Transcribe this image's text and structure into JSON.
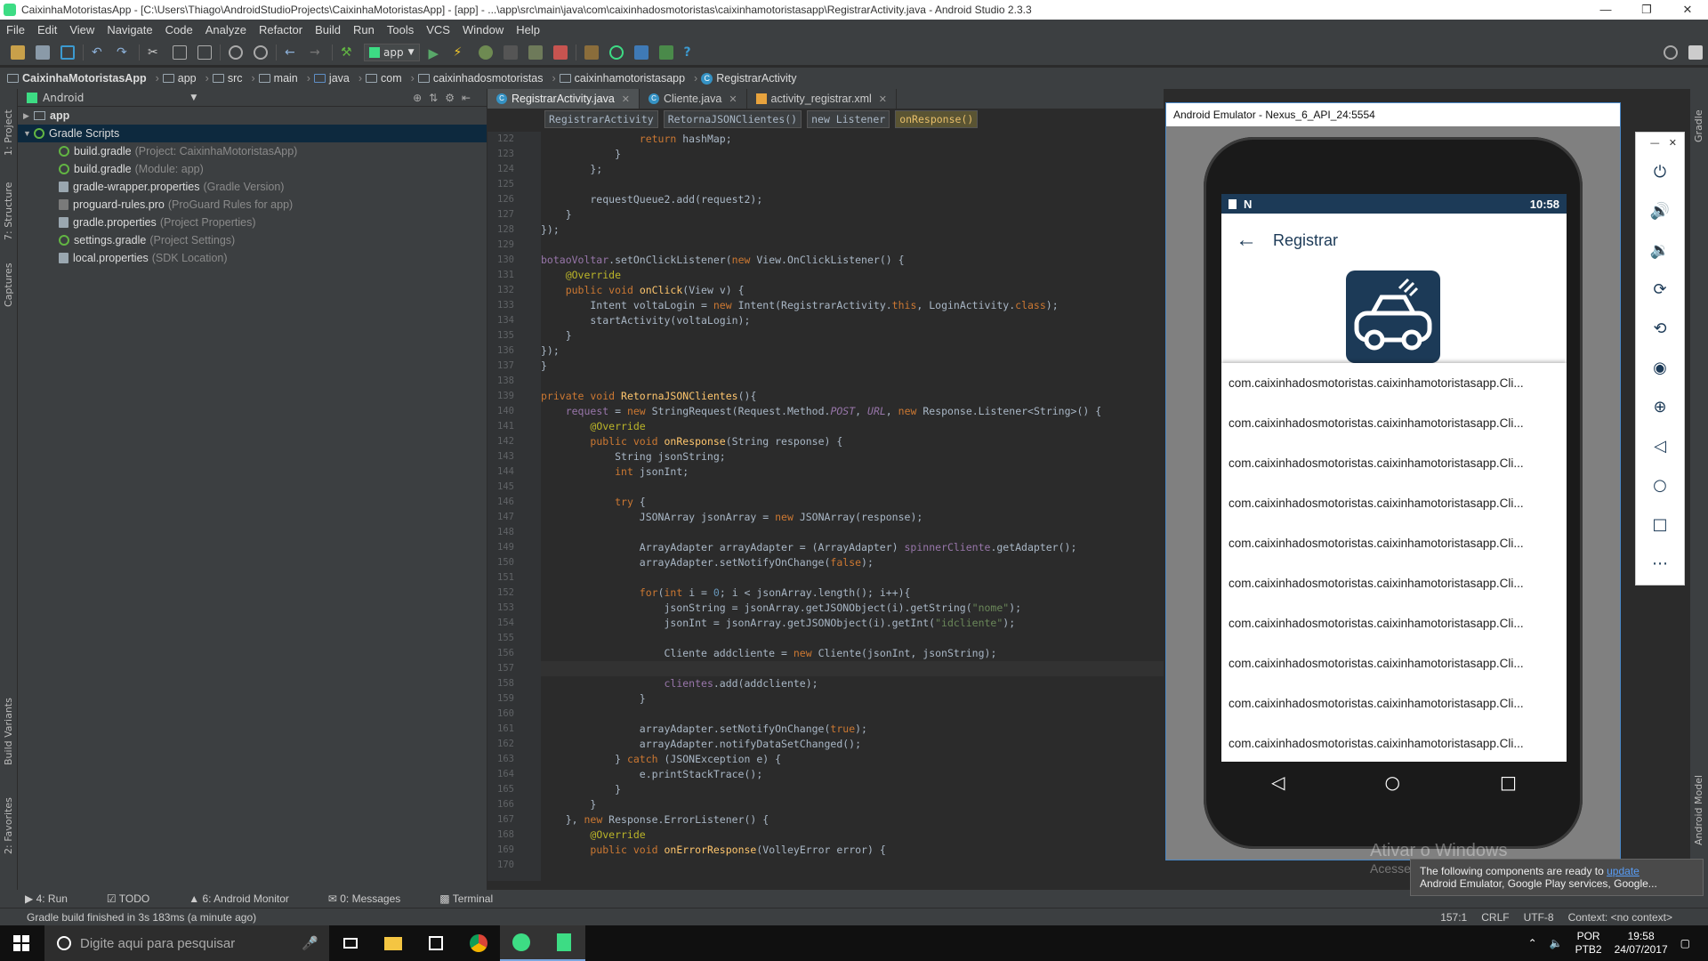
{
  "window": {
    "title": "CaixinhaMotoristasApp - [C:\\Users\\Thiago\\AndroidStudioProjects\\CaixinhaMotoristasApp] - [app] - ...\\app\\src\\main\\java\\com\\caixinhadosmotoristas\\caixinhamotoristasapp\\RegistrarActivity.java - Android Studio 2.3.3"
  },
  "menu": [
    "File",
    "Edit",
    "View",
    "Navigate",
    "Code",
    "Analyze",
    "Refactor",
    "Build",
    "Run",
    "Tools",
    "VCS",
    "Window",
    "Help"
  ],
  "toolbar": {
    "run_config": "app"
  },
  "breadcrumb": [
    "CaixinhaMotoristasApp",
    "app",
    "src",
    "main",
    "java",
    "com",
    "caixinhadosmotoristas",
    "caixinhamotoristasapp",
    "RegistrarActivity"
  ],
  "project": {
    "view": "Android",
    "tree": [
      {
        "label": "app",
        "hint": "",
        "level": 0
      },
      {
        "label": "Gradle Scripts",
        "hint": "",
        "level": 0
      },
      {
        "label": "build.gradle",
        "hint": "(Project: CaixinhaMotoristasApp)",
        "level": 1
      },
      {
        "label": "build.gradle",
        "hint": "(Module: app)",
        "level": 1
      },
      {
        "label": "gradle-wrapper.properties",
        "hint": "(Gradle Version)",
        "level": 1
      },
      {
        "label": "proguard-rules.pro",
        "hint": "(ProGuard Rules for app)",
        "level": 1
      },
      {
        "label": "gradle.properties",
        "hint": "(Project Properties)",
        "level": 1
      },
      {
        "label": "settings.gradle",
        "hint": "(Project Settings)",
        "level": 1
      },
      {
        "label": "local.properties",
        "hint": "(SDK Location)",
        "level": 1
      }
    ]
  },
  "left_strip": [
    "1: Project",
    "7: Structure",
    "Captures",
    "Build Variants",
    "2: Favorites"
  ],
  "right_strip": [
    "Gradle",
    "Android Model"
  ],
  "editor": {
    "tabs": [
      "RegistrarActivity.java",
      "Cliente.java",
      "activity_registrar.xml"
    ],
    "context": [
      "RegistrarActivity",
      "RetornaJSONClientes()",
      "new Listener",
      "onResponse()"
    ],
    "first_line": 122
  },
  "emulator": {
    "title": "Android Emulator - Nexus_6_API_24:5554",
    "status_time": "10:58",
    "app_title": "Registrar",
    "list_item": "com.caixinhadosmotoristas.caixinhamotoristasapp.Cli...",
    "list_count": 10
  },
  "tool_windows": [
    "4: Run",
    "TODO",
    "6: Android Monitor",
    "0: Messages",
    "Terminal"
  ],
  "status": {
    "message": "Gradle build finished in 3s 183ms (a minute ago)",
    "position": "157:1",
    "line_sep": "CRLF",
    "encoding": "UTF-8",
    "context": "Context: <no context>"
  },
  "notification": {
    "line1": "The following components are ready to ",
    "link": "update",
    "line2": "Android Emulator, Google Play services, Google..."
  },
  "watermark": {
    "line1": "Ativar o Windows",
    "line2": "Acesse Con"
  },
  "taskbar": {
    "search_placeholder": "Digite aqui para pesquisar",
    "lang1": "POR",
    "lang2": "PTB2",
    "time": "19:58",
    "date": "24/07/2017"
  }
}
